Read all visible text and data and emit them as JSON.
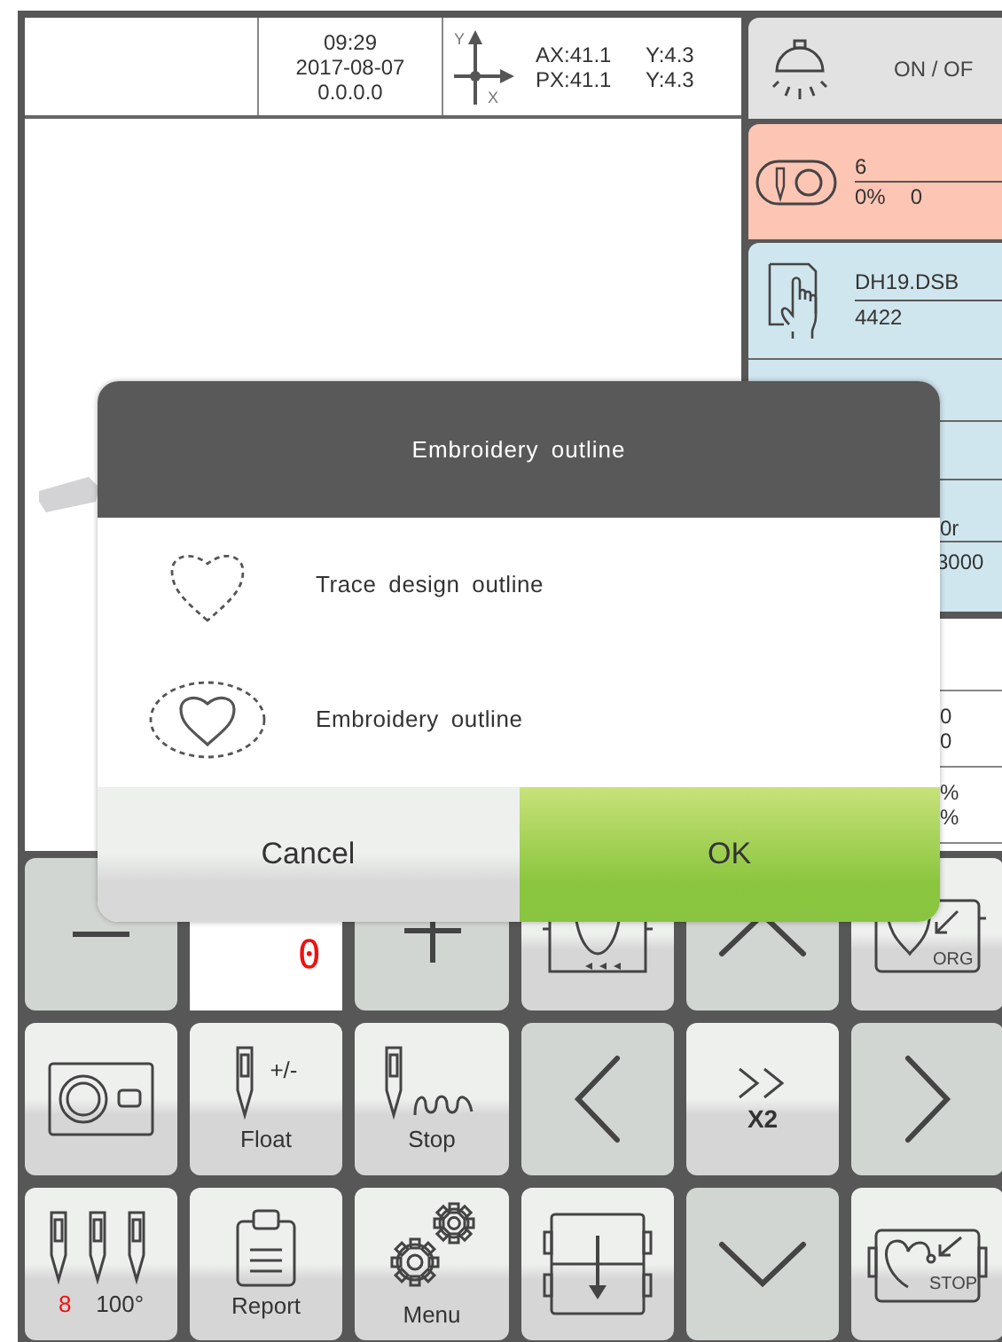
{
  "status": {
    "time": "09:29",
    "date": "2017-08-07",
    "version": "0.0.0.0",
    "axis_y": "Y",
    "axis_x": "X",
    "ax": "AX:41.1",
    "ay": "Y:4.3",
    "px": "PX:41.1",
    "py": "Y:4.3"
  },
  "lamp": {
    "label": "ON / OF"
  },
  "needle_panel": {
    "color_count": "6",
    "percent": "0%",
    "stitches": "0"
  },
  "file_panel": {
    "file_name": "DH19.DSB",
    "stitch_count": "4422"
  },
  "info_panel": {
    "line_1": "0r",
    "line_2": "3000"
  },
  "stats_panel": {
    "rows": [
      [
        "0",
        "0"
      ],
      [
        "%",
        "%"
      ]
    ]
  },
  "keypad": [
    {
      "kind": "nav"
    },
    {
      "kind": "value",
      "value": "0"
    },
    {
      "kind": "nav"
    },
    {
      "kind": "action"
    },
    {
      "kind": "nav"
    },
    {
      "kind": "action",
      "badge": "ORG"
    },
    {
      "kind": "action"
    },
    {
      "kind": "action",
      "label": "Float",
      "badge": "+/-"
    },
    {
      "kind": "action",
      "label": "Stop"
    },
    {
      "kind": "nav"
    },
    {
      "kind": "action",
      "label": "X2"
    },
    {
      "kind": "nav"
    },
    {
      "kind": "action",
      "count": "8",
      "label": "100°"
    },
    {
      "kind": "action",
      "label": "Report"
    },
    {
      "kind": "action",
      "label": "Menu"
    },
    {
      "kind": "action"
    },
    {
      "kind": "nav"
    },
    {
      "kind": "action",
      "badge": "STOP"
    }
  ],
  "dialog": {
    "title": "Embroidery outline",
    "options": [
      {
        "label": "Trace design outline"
      },
      {
        "label": "Embroidery outline"
      }
    ],
    "buttons": [
      {
        "label": "Cancel",
        "kind": "cancel"
      },
      {
        "label": "OK",
        "kind": "confirm"
      }
    ]
  }
}
